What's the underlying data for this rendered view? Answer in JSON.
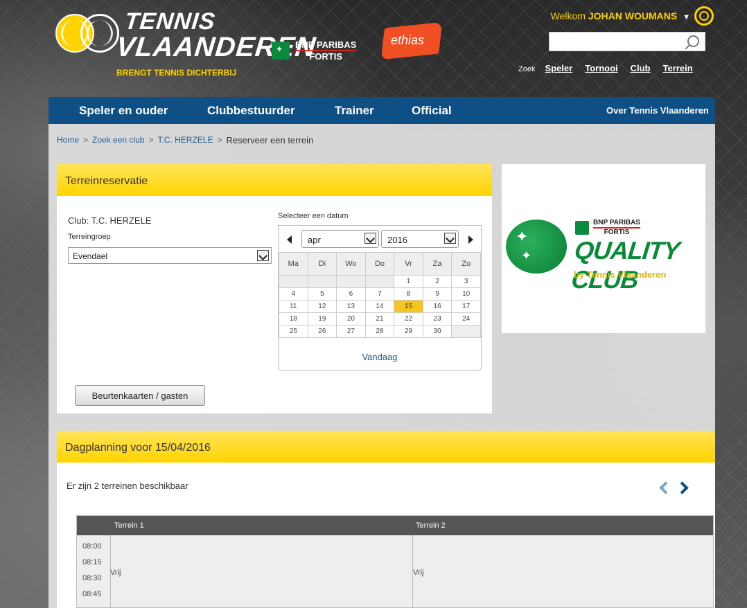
{
  "header": {
    "brand_line1": "TENNIS",
    "brand_line2": "VLAANDEREN",
    "brand_tagline": "BRENGT TENNIS DICHTERBIJ",
    "sponsor_bnp_line1": "BNP PARIBAS",
    "sponsor_bnp_line2": "FORTIS",
    "sponsor_ethias": "ethias",
    "welcome_prefix": "Welkom",
    "user_name": "JOHAN WOUMANS",
    "search": {
      "placeholder": "",
      "value": "",
      "label": "Zoek",
      "links": [
        "Speler",
        "Tornooi",
        "Club",
        "Terrein"
      ]
    }
  },
  "nav": {
    "items": [
      "Speler en ouder",
      "Clubbestuurder",
      "Trainer",
      "Official"
    ],
    "right": "Over Tennis Vlaanderen"
  },
  "breadcrumb": {
    "items": [
      "Home",
      "Zoek een club",
      "T.C. HERZELE"
    ],
    "separator": ">",
    "current": "Reserveer een terrein"
  },
  "reservation": {
    "title": "Terreinreservatie",
    "club": "Club: T.C. HERZELE",
    "group_label": "Terreingroep",
    "group_value": "Evendael",
    "date_label": "Selecteer een datum",
    "month": "apr",
    "year": "2016",
    "weekdays": [
      "Ma",
      "Di",
      "Wo",
      "Do",
      "Vr",
      "Za",
      "Zo"
    ],
    "weeks": [
      [
        "",
        "",
        "",
        "",
        "1",
        "2",
        "3"
      ],
      [
        "4",
        "5",
        "6",
        "7",
        "8",
        "9",
        "10"
      ],
      [
        "11",
        "12",
        "13",
        "14",
        "15",
        "16",
        "17"
      ],
      [
        "18",
        "19",
        "20",
        "21",
        "22",
        "23",
        "24"
      ],
      [
        "25",
        "26",
        "27",
        "28",
        "29",
        "30",
        ""
      ]
    ],
    "selected_day": "15",
    "today_label": "Vandaag",
    "cards_button": "Beurtenkaarten / gasten"
  },
  "promo": {
    "bnp_line1": "BNP PARIBAS",
    "bnp_line2": "FORTIS",
    "title": "QUALITY CLUB",
    "subtitle": "by Tennis Vlaanderen"
  },
  "planning": {
    "title": "Dagplanning voor 15/04/2016",
    "available": "Er zijn 2 terreinen beschikbaar",
    "courts": [
      "Terrein 1",
      "Terrein 2"
    ],
    "times": [
      "08:00",
      "08:15",
      "08:30",
      "08:45"
    ],
    "status": "Vrij"
  },
  "colors": {
    "accent_yellow": "#ffd400",
    "nav_blue": "#0e4f86",
    "link_blue": "#1c5b94",
    "selected_day": "#f6c421"
  }
}
